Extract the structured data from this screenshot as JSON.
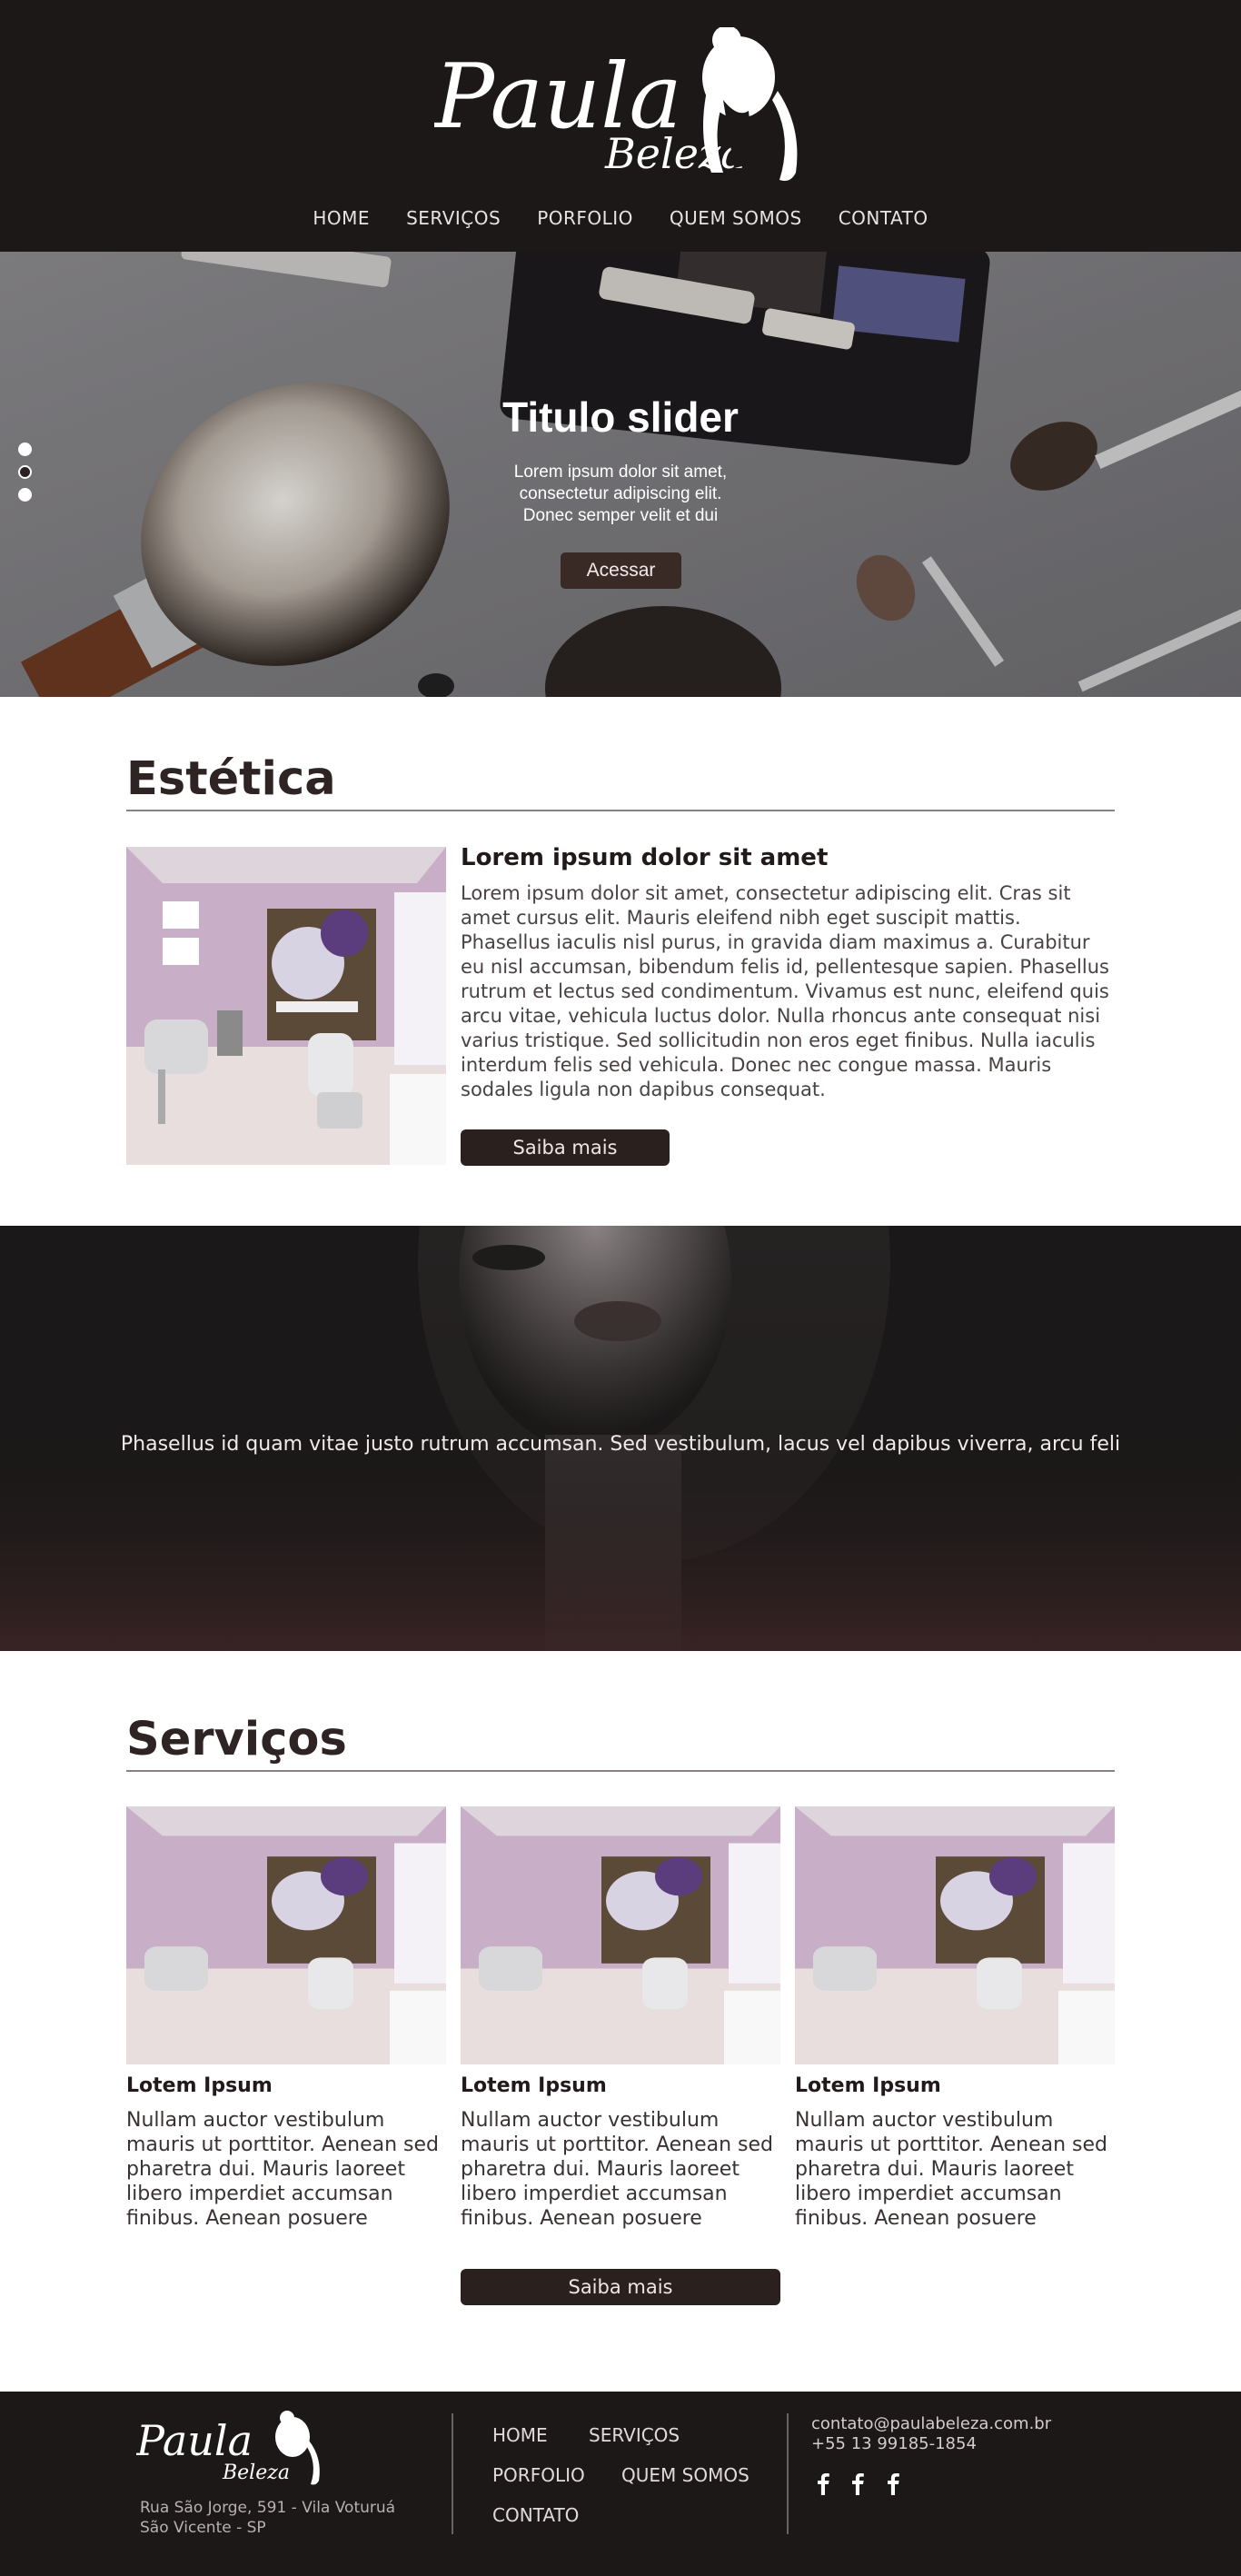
{
  "brand": {
    "logo_primary": "Paula",
    "logo_secondary": "Beleza"
  },
  "nav": {
    "items": [
      "HOME",
      "SERVIÇOS",
      "PORFOLIO",
      "QUEM SOMOS",
      "CONTATO"
    ]
  },
  "slider": {
    "title": "Titulo slider",
    "text_lines": [
      "Lorem ipsum dolor sit amet,",
      "consectetur adipiscing elit.",
      "Donec semper velit et dui"
    ],
    "button_label": "Acessar",
    "dots_total": 3,
    "active_dot": 2
  },
  "estetica": {
    "title": "Estética",
    "heading": "Lorem ipsum dolor sit amet",
    "body": "Lorem ipsum dolor sit amet, consectetur adipiscing elit. Cras sit amet cursus elit. Mauris eleifend nibh eget suscipit mattis. Phasellus iaculis nisl purus, in gravida diam maximus a. Curabitur eu nisl accumsan, bibendum felis id, pellentesque sapien. Phasellus rutrum et lectus sed condimentum. Vivamus est nunc, eleifend quis arcu vitae, vehicula luctus dolor. Nulla rhoncus ante consequat nisi varius tristique. Sed sollicitudin non eros eget finibus. Nulla iaculis interdum felis sed vehicula. Donec nec congue massa. Mauris sodales ligula non dapibus consequat.",
    "button_label": "Saiba mais"
  },
  "quote": {
    "text": "Phasellus id quam vitae justo rutrum accumsan. Sed vestibulum, lacus vel dapibus viverra, arcu feli"
  },
  "servicos": {
    "title": "Serviços",
    "cards": [
      {
        "title": "Lotem Ipsum",
        "text": "Nullam auctor vestibulum mauris ut porttitor. Aenean sed pharetra dui. Mauris laoreet libero imperdiet accumsan finibus. Aenean posuere"
      },
      {
        "title": "Lotem Ipsum",
        "text": "Nullam auctor vestibulum mauris ut porttitor. Aenean sed pharetra dui. Mauris laoreet libero imperdiet accumsan finibus. Aenean posuere"
      },
      {
        "title": "Lotem Ipsum",
        "text": "Nullam auctor vestibulum mauris ut porttitor. Aenean sed pharetra dui. Mauris laoreet libero imperdiet accumsan finibus. Aenean posuere"
      }
    ],
    "button_label": "Saiba mais"
  },
  "footer": {
    "address_line1": "Rua São Jorge, 591 -  Vila Voturuá",
    "address_line2": "São Vicente - SP",
    "links": [
      "HOME",
      "SERVIÇOS",
      "PORFOLIO",
      "QUEM SOMOS",
      "CONTATO"
    ],
    "email": "contato@paulabeleza.com.br",
    "phone": "+55 13 99185-1854",
    "social_icons": [
      "facebook-icon",
      "facebook-icon",
      "facebook-icon"
    ]
  },
  "colors": {
    "dark": "#1c1818",
    "button": "#2a201e",
    "text": "#2e2424",
    "accent_lilac": "#c9aec8"
  }
}
